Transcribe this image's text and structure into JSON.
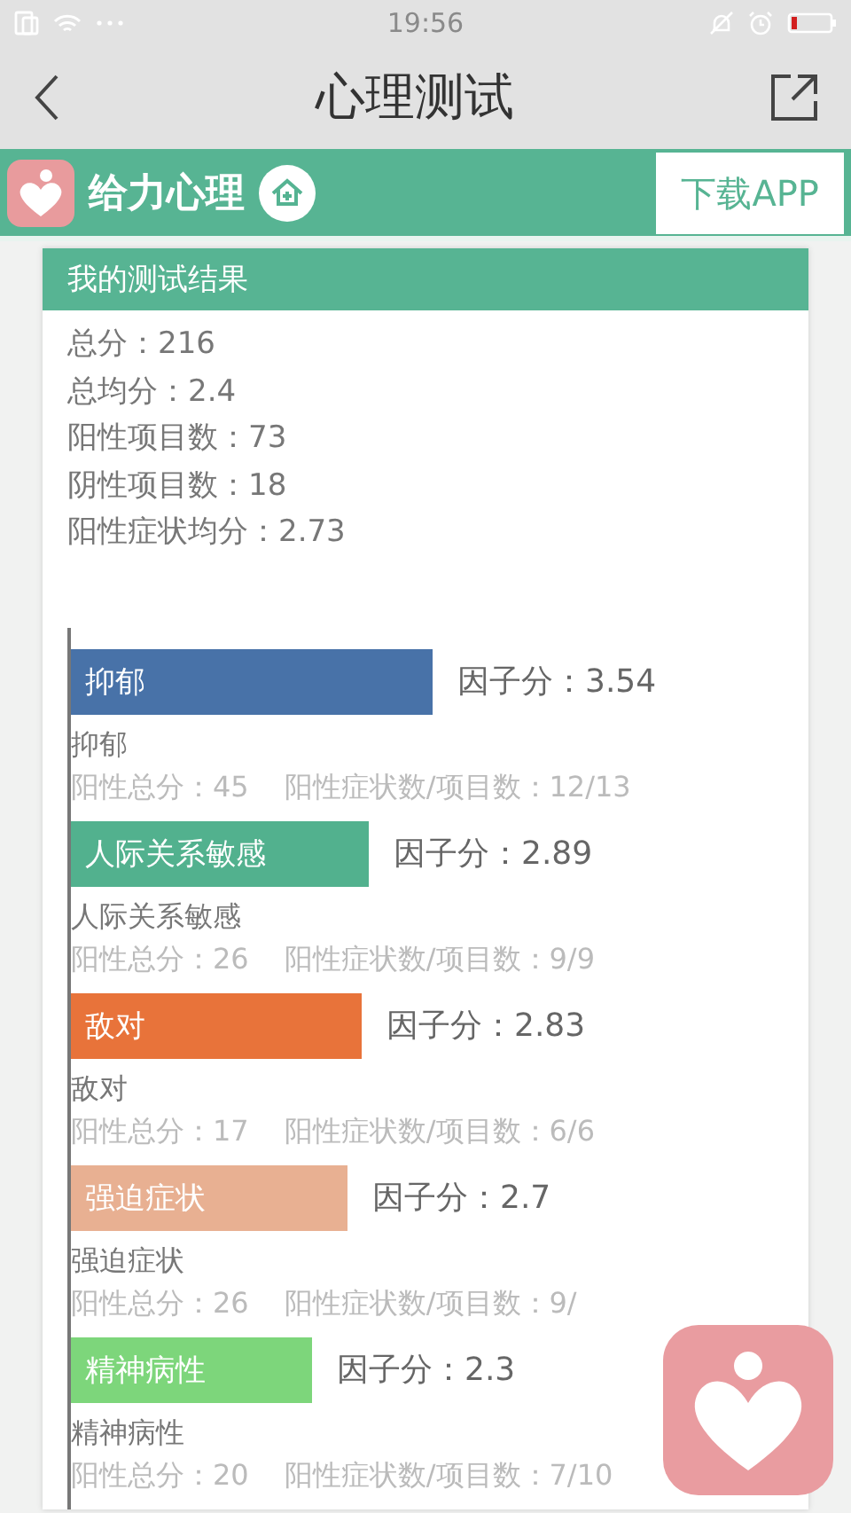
{
  "status_bar": {
    "time": "19:56"
  },
  "nav": {
    "title": "心理测试"
  },
  "banner": {
    "brand": "给力心理",
    "download": "下载APP"
  },
  "result": {
    "title": "我的测试结果",
    "summary": [
      "总分：216",
      "总均分：2.4",
      "阳性项目数：73",
      "阴性项目数：18",
      "阳性症状均分：2.73"
    ],
    "factors": [
      {
        "name": "抑郁",
        "color": "#4872a8",
        "score": "因子分：3.54",
        "label": "抑郁",
        "total": "阳性总分：45",
        "ratio": "阳性症状数/项目数：12/13"
      },
      {
        "name": "人际关系敏感",
        "color": "#52b18e",
        "score": "因子分：2.89",
        "label": "人际关系敏感",
        "total": "阳性总分：26",
        "ratio": "阳性症状数/项目数：9/9"
      },
      {
        "name": "敌对",
        "color": "#e8733a",
        "score": "因子分：2.83",
        "label": "敌对",
        "total": "阳性总分：17",
        "ratio": "阳性症状数/项目数：6/6"
      },
      {
        "name": "强迫症状",
        "color": "#e8b092",
        "score": "因子分：2.7",
        "label": "强迫症状",
        "total": "阳性总分：26",
        "ratio": "阳性症状数/项目数：9/"
      },
      {
        "name": "精神病性",
        "color": "#7dd67b",
        "score": "因子分：2.3",
        "label": "精神病性",
        "total": "阳性总分：20",
        "ratio": "阳性症状数/项目数：7/10"
      }
    ]
  }
}
